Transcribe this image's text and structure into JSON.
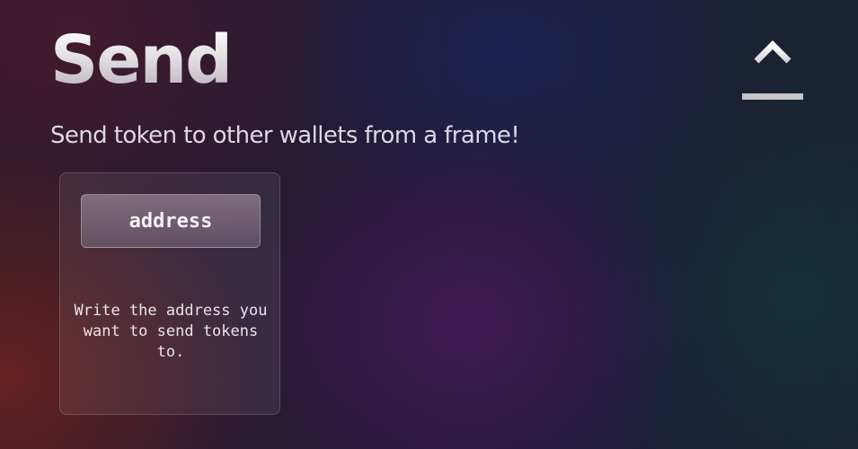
{
  "header": {
    "title": "Send",
    "subtitle": "Send token to other wallets from a frame!",
    "icon": "upload-icon"
  },
  "card": {
    "button_label": "address",
    "description": "Write the address you want to send tokens to."
  },
  "colors": {
    "title_text": "#e6e2e5",
    "body_text": "#ddd8e2",
    "icon": "#ffffff"
  }
}
